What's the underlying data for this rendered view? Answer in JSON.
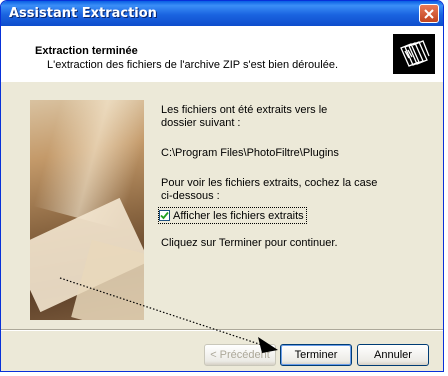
{
  "window": {
    "title": "Assistant Extraction"
  },
  "header": {
    "title": "Extraction terminée",
    "subtitle": "L'extraction des fichiers de l'archive ZIP s'est bien déroulée."
  },
  "content": {
    "line1": "Les fichiers ont été extraits vers le",
    "line1b": "dossier suivant :",
    "path": "C:\\Program Files\\PhotoFiltre\\Plugins",
    "line3": "Pour voir les fichiers extraits, cochez la case",
    "line3b": "ci-dessous :",
    "checkbox_label": "Afficher les fichiers extraits",
    "checkbox_checked": true,
    "continue_text": "Cliquez sur Terminer pour continuer."
  },
  "buttons": {
    "prev": "< Précédent",
    "finish": "Terminer",
    "cancel": "Annuler"
  },
  "icons": {
    "close": "close-icon",
    "header": "files-icon",
    "checkbox": "checkmark-icon"
  }
}
